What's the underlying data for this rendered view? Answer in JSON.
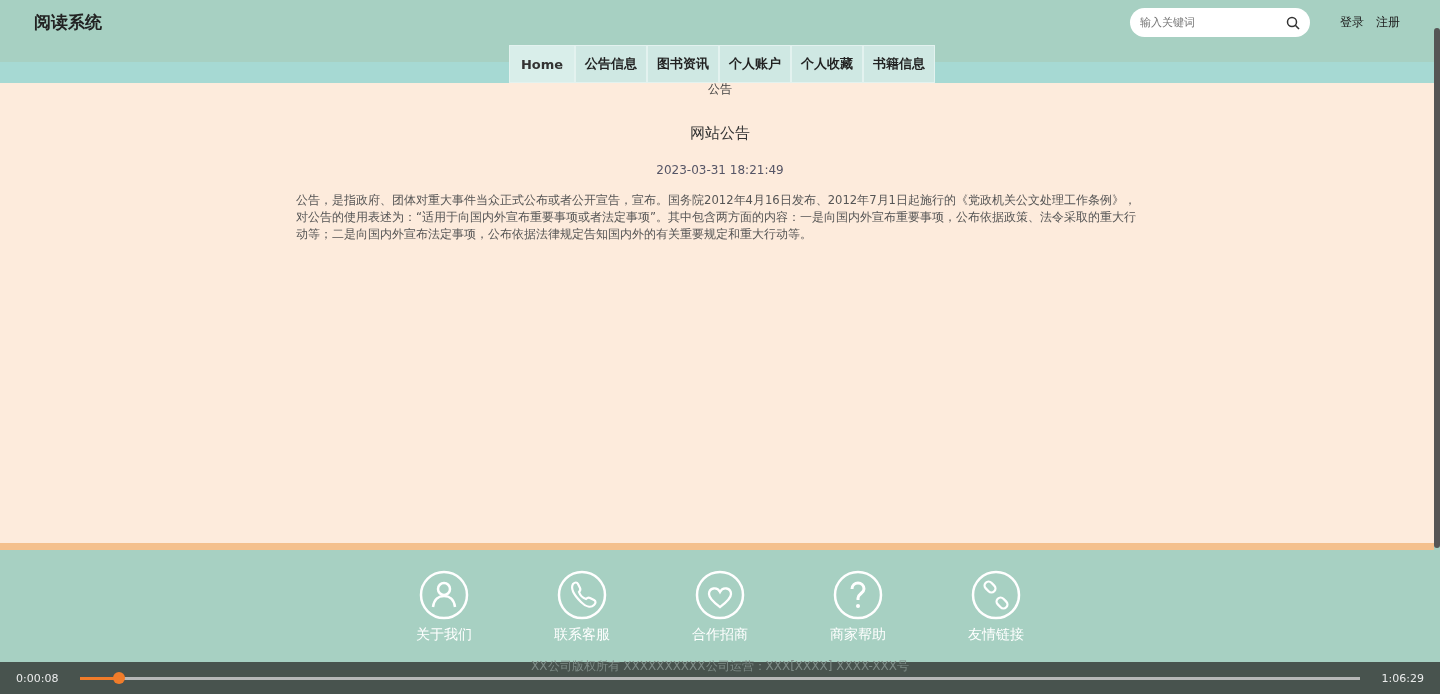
{
  "header": {
    "logo": "阅读系统",
    "search": {
      "placeholder": "输入关键词"
    },
    "links": [
      "登录",
      "注册"
    ]
  },
  "nav": [
    {
      "label": "Home",
      "selected": true
    },
    {
      "label": "公告信息",
      "selected": false
    },
    {
      "label": "图书资讯",
      "selected": false
    },
    {
      "label": "个人账户",
      "selected": false
    },
    {
      "label": "个人收藏",
      "selected": false
    },
    {
      "label": "书籍信息",
      "selected": false
    }
  ],
  "breadcrumb": "公告",
  "article": {
    "title": "网站公告",
    "date": "2023-03-31 18:21:49",
    "body": "公告，是指政府、团体对重大事件当众正式公布或者公开宣告，宣布。国务院2012年4月16日发布、2012年7月1日起施行的《党政机关公文处理工作条例》，对公告的使用表述为：“适用于向国内外宣布重要事项或者法定事项”。其中包含两方面的内容：一是向国内外宣布重要事项，公布依据政策、法令采取的重大行动等；二是向国内外宣布法定事项，公布依据法律规定告知国内外的有关重要规定和重大行动等。"
  },
  "footer": {
    "links": [
      {
        "label": "关于我们",
        "kind": "person"
      },
      {
        "label": "联系客服",
        "kind": "phone"
      },
      {
        "label": "合作招商",
        "kind": "handshake"
      },
      {
        "label": "商家帮助",
        "kind": "help"
      },
      {
        "label": "友情链接",
        "kind": "link"
      }
    ],
    "copyright": "XX公司版权所有 XXXXXXXXXX公司运营：XXX[XXXX] XXXX-XXX号"
  },
  "player": {
    "current_time": "0:00:08",
    "duration": "1:06:29",
    "level": 0.03
  }
}
